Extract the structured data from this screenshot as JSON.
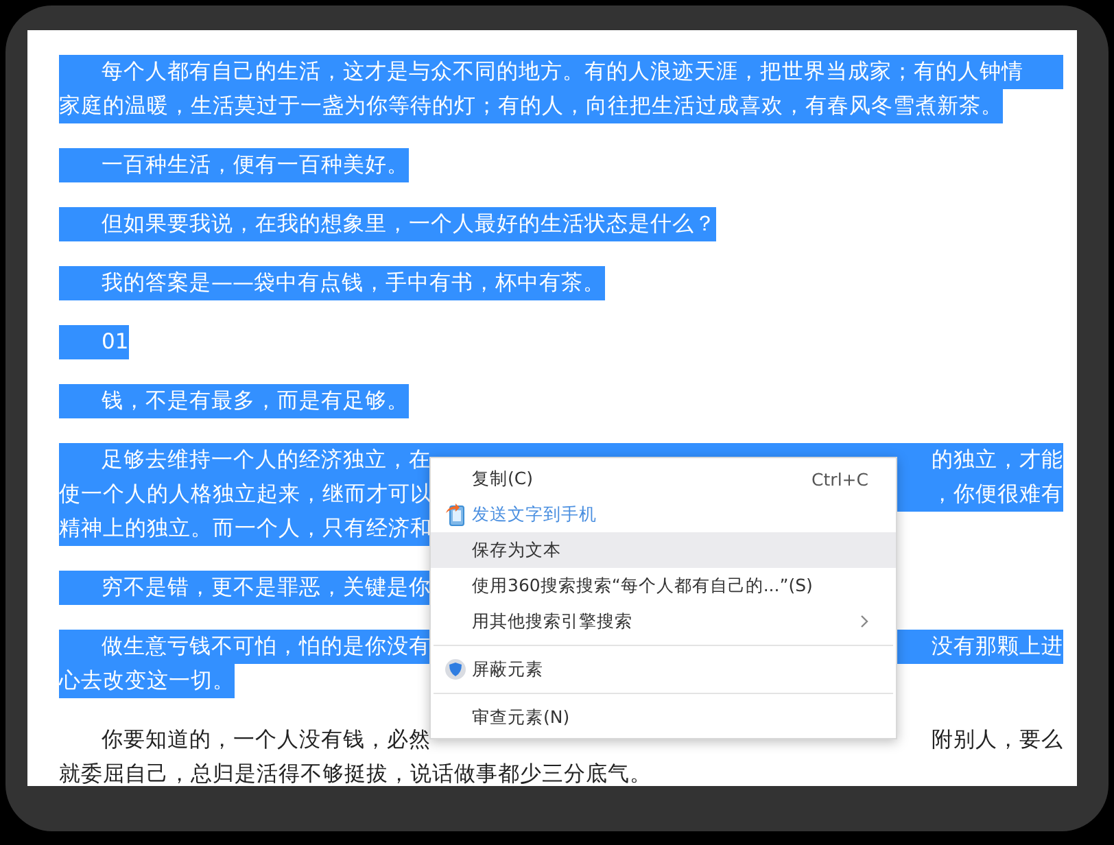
{
  "paragraphs": [
    {
      "selected": true,
      "lines": [
        {
          "text": "每个人都有自己的生活，这才是与众不同的地方。有的人浪迹天涯，把世界当成家；有的人钟情"
        },
        {
          "text": "家庭的温暖，生活莫过于一盏为你等待的灯；有的人，向往把生活过成喜欢，有春风冬雪煮新茶。"
        }
      ]
    },
    {
      "selected": true,
      "lines": [
        {
          "text": "一百种生活，便有一百种美好。"
        }
      ]
    },
    {
      "selected": true,
      "lines": [
        {
          "text": "但如果要我说，在我的想象里，一个人最好的生活状态是什么？"
        }
      ]
    },
    {
      "selected": true,
      "lines": [
        {
          "text": "我的答案是——袋中有点钱，手中有书，杯中有茶。"
        }
      ]
    },
    {
      "selected": true,
      "lines": [
        {
          "text": "01"
        }
      ]
    },
    {
      "selected": true,
      "lines": [
        {
          "text": "钱，不是有最多，而是有足够。"
        }
      ]
    },
    {
      "selected": true,
      "lines": [
        {
          "text": "足够去维持一个人的经济独立，在",
          "tail": "的独立，才能"
        },
        {
          "text": "使一个人的人格独立起来，继而才可以",
          "tail": "，你便很难有"
        },
        {
          "text": "精神上的独立。而一个人，只有经济和"
        }
      ]
    },
    {
      "selected": true,
      "lines": [
        {
          "text": "穷不是错，更不是罪恶，关键是你"
        }
      ]
    },
    {
      "selected": true,
      "lines": [
        {
          "text": "做生意亏钱不可怕，怕的是你没有",
          "tail": "没有那颗上进"
        },
        {
          "text": "心去改变这一切。"
        }
      ]
    },
    {
      "selected": false,
      "lines": [
        {
          "text": "你要知道的，一个人没有钱，必然",
          "tail": "附别人，要么"
        },
        {
          "text": "就委屈自己，总归是活得不够挺拔，说话做事都少三分底气。"
        }
      ]
    }
  ],
  "context_menu": [
    {
      "kind": "plain",
      "label": "复制(C)",
      "shortcut": "Ctrl+C",
      "selected": false
    },
    {
      "kind": "send",
      "label": "发送文字到手机",
      "selected": false
    },
    {
      "kind": "plain",
      "label": "保存为文本",
      "selected": true
    },
    {
      "kind": "plain",
      "label": "使用360搜索搜索“每个人都有自己的...”(S)",
      "selected": false
    },
    {
      "kind": "submenu",
      "label": "用其他搜索引擎搜索",
      "selected": false
    },
    {
      "kind": "separator"
    },
    {
      "kind": "block",
      "label": "屏蔽元素",
      "selected": false
    },
    {
      "kind": "separator"
    },
    {
      "kind": "plain",
      "label": "审查元素(N)",
      "selected": false
    }
  ]
}
